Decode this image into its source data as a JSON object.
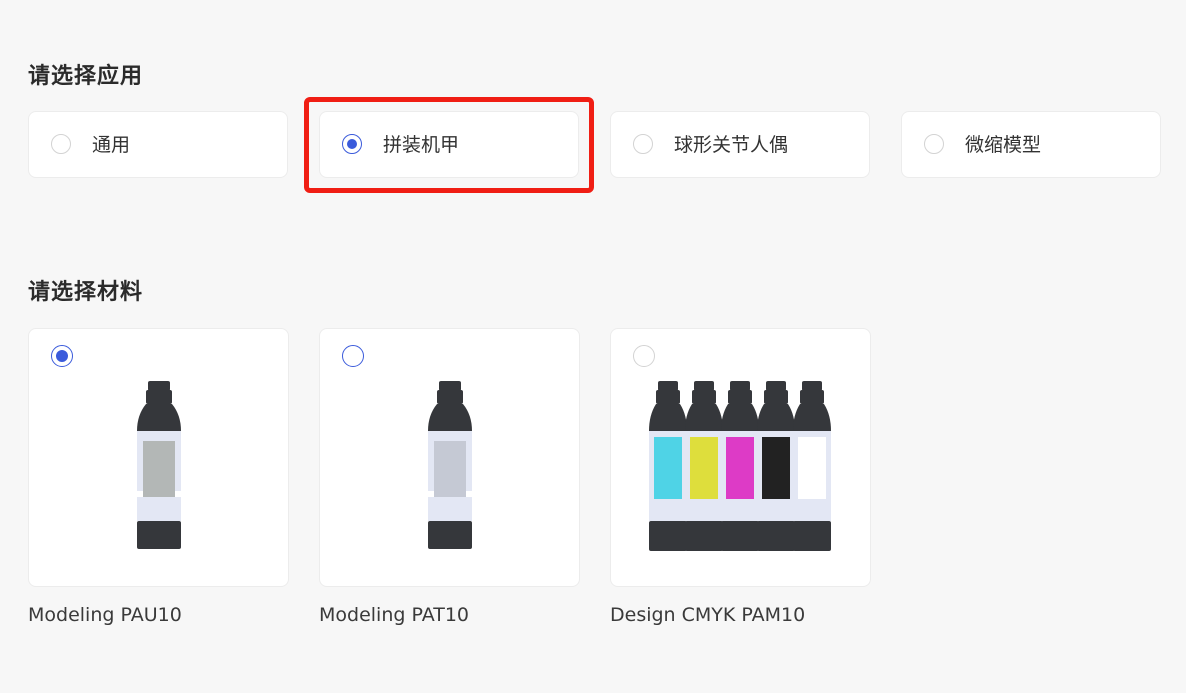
{
  "application_section": {
    "title": "请选择应用",
    "options": [
      {
        "label": "通用",
        "selected": false
      },
      {
        "label": "拼装机甲",
        "selected": true
      },
      {
        "label": "球形关节人偶",
        "selected": false
      },
      {
        "label": "微缩模型",
        "selected": false
      }
    ]
  },
  "material_section": {
    "title": "请选择材料",
    "options": [
      {
        "name": "Modeling PAU10",
        "selected": true,
        "image": "single-bottle-gray-label"
      },
      {
        "name": "Modeling PAT10",
        "selected": false,
        "image": "single-bottle-light-label"
      },
      {
        "name": "Design CMYK PAM10",
        "selected": false,
        "image": "five-bottles-cmyk-white"
      }
    ]
  },
  "colors": {
    "accent": "#3b5bdb",
    "highlight": "#f01e14",
    "bottle_dark": "#35373b",
    "cyan": "#4fd3e6",
    "yellow": "#dede3c",
    "magenta": "#dd3bc6",
    "black": "#222222",
    "white": "#ffffff"
  }
}
